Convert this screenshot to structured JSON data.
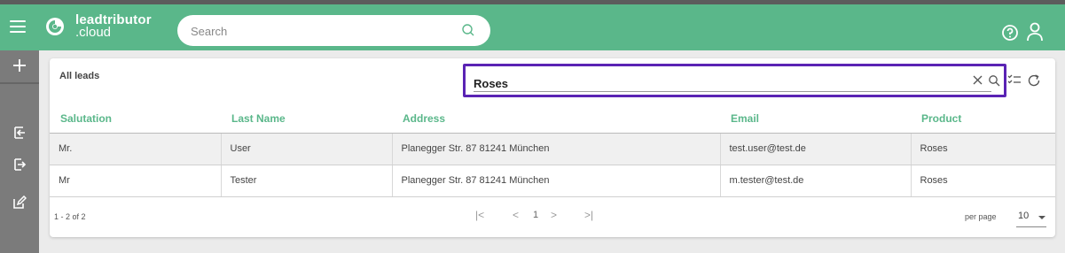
{
  "app": {
    "brand_line1": "leadtributor",
    "brand_line2": ".cloud"
  },
  "search": {
    "placeholder": "Search"
  },
  "card": {
    "title": "All leads"
  },
  "filter": {
    "value": "Roses"
  },
  "table": {
    "headers": [
      "Salutation",
      "Last Name",
      "Address",
      "Email",
      "Product"
    ],
    "rows": [
      [
        "Mr.",
        "User",
        "Planegger Str. 87 81241 München",
        "test.user@test.de",
        "Roses"
      ],
      [
        "Mr",
        "Tester",
        "Planegger Str. 87 81241 München",
        "m.tester@test.de",
        "Roses"
      ]
    ]
  },
  "pagination": {
    "range": "1 - 2 of 2",
    "first": "|<",
    "prev": "<",
    "page": "1",
    "next": ">",
    "last": ">|",
    "per_page_label": "per page",
    "per_page_value": "10"
  },
  "colors": {
    "brand_green": "#5ab78a",
    "focus_purple": "#5a23b4",
    "sidebar": "#7b7b7b"
  },
  "icons": [
    "menu-icon",
    "logo-icon",
    "search-icon",
    "help-icon",
    "user-icon",
    "plus-icon",
    "import-icon",
    "export-icon",
    "edit-icon",
    "clear-icon",
    "checklist-icon",
    "refresh-icon"
  ]
}
